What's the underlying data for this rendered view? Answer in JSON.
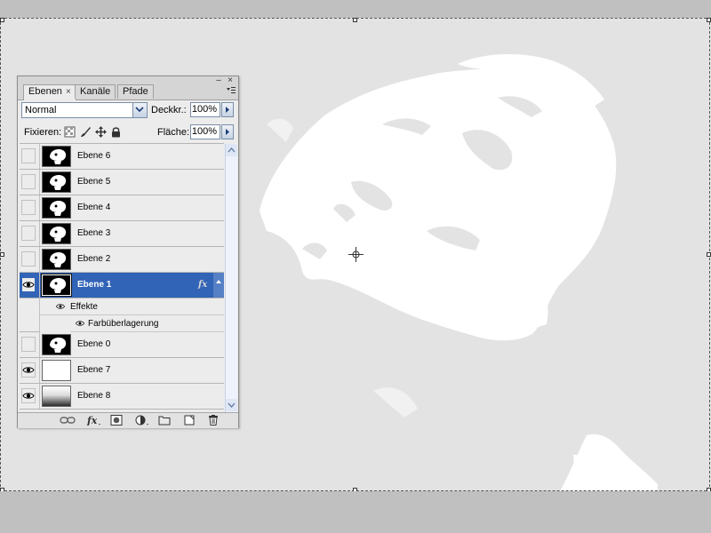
{
  "panel": {
    "tabs": [
      {
        "label": "Ebenen",
        "active": true,
        "close": "×"
      },
      {
        "label": "Kanäle",
        "active": false
      },
      {
        "label": "Pfade",
        "active": false
      }
    ],
    "window_controls": {
      "minimize": "–",
      "close": "×"
    },
    "blend_mode": "Normal",
    "opacity_label": "Deckkr.:",
    "opacity_value": "100%",
    "lock_label": "Fixieren:",
    "fill_label": "Fläche:",
    "fill_value": "100%"
  },
  "layers": [
    {
      "name": "Ebene 6",
      "visible": false,
      "thumb": "portrait"
    },
    {
      "name": "Ebene 5",
      "visible": false,
      "thumb": "portrait"
    },
    {
      "name": "Ebene 4",
      "visible": false,
      "thumb": "portrait"
    },
    {
      "name": "Ebene 3",
      "visible": false,
      "thumb": "portrait"
    },
    {
      "name": "Ebene 2",
      "visible": false,
      "thumb": "portrait"
    },
    {
      "name": "Ebene 1",
      "visible": true,
      "selected": true,
      "thumb": "portrait",
      "fx": "fx"
    },
    {
      "name": "Ebene 0",
      "visible": false,
      "thumb": "portrait"
    },
    {
      "name": "Ebene 7",
      "visible": true,
      "thumb": "white"
    },
    {
      "name": "Ebene 8",
      "visible": true,
      "thumb": "gradient"
    }
  ],
  "effects": {
    "group_label": "Effekte",
    "items": [
      "Farbüberlagerung"
    ]
  },
  "colors": {
    "selection": "#3163b6",
    "canvas": "#e3e3e3",
    "workspace": "#c0c0c0"
  }
}
